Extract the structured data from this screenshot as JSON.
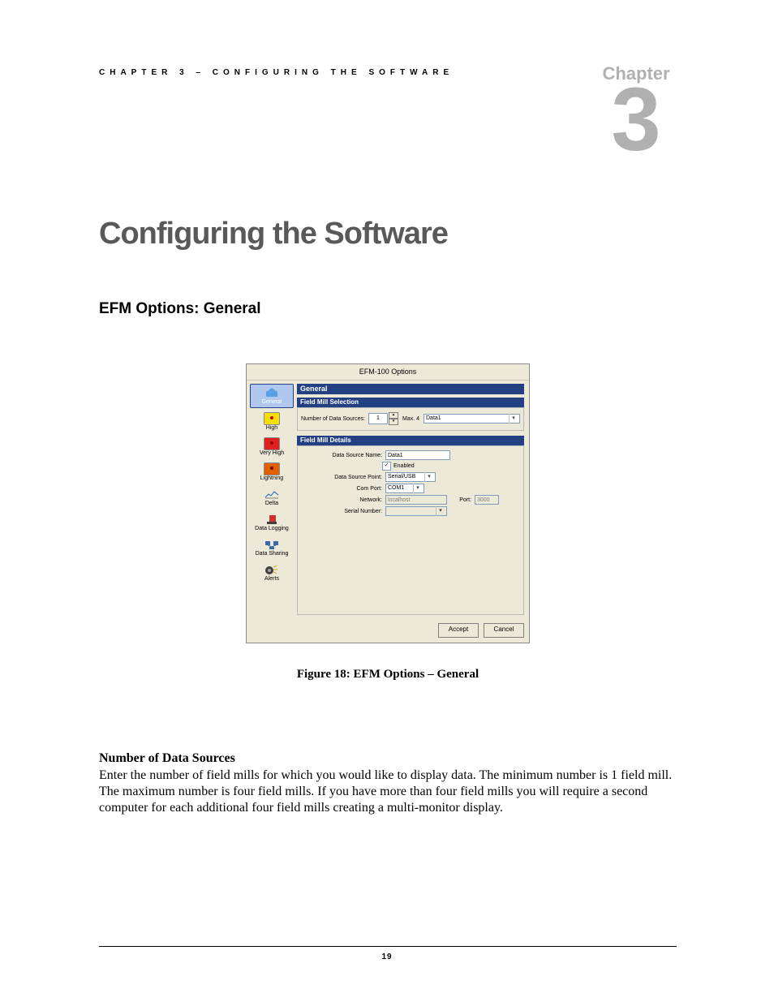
{
  "header": {
    "running_head": "CHAPTER 3 – CONFIGURING THE SOFTWARE",
    "chapter_label": "Chapter",
    "chapter_number": "3"
  },
  "title": "Configuring the Software",
  "section_head": "EFM Options: General",
  "dialog": {
    "title": "EFM-100 Options",
    "sidebar": [
      {
        "label": "General"
      },
      {
        "label": "High"
      },
      {
        "label": "Very High"
      },
      {
        "label": "Lightning"
      },
      {
        "label": "Delta"
      },
      {
        "label": "Data Logging"
      },
      {
        "label": "Data Sharing"
      },
      {
        "label": "Alerts"
      }
    ],
    "group_general": "General",
    "group_selection": "Field Mill Selection",
    "group_details": "Field Mill Details",
    "num_sources_label": "Number of Data Sources:",
    "num_sources_value": "1",
    "num_sources_max_label": "Max. 4",
    "num_sources_dropdown": "Data1",
    "ds_name_label": "Data Source Name:",
    "ds_name_value": "Data1",
    "enabled_label": "Enabled",
    "dsp_label": "Data Source Point:",
    "dsp_value": "Serial/USB",
    "com_label": "Com Port:",
    "com_value": "COM1",
    "net_label": "Network:",
    "net_value": "localhost",
    "port_label": "Port:",
    "port_value": "3000",
    "sn_label": "Serial Number:",
    "sn_value": "",
    "accept": "Accept",
    "cancel": "Cancel"
  },
  "figure_caption": "Figure 18:  EFM Options – General",
  "body": {
    "sub_head": "Number of Data Sources",
    "para": "Enter the number of field mills for which you would like to display data.  The minimum number is 1 field mill.  The maximum number is four field mills.  If you have more than four field mills you will require a second computer for each additional four field mills creating a multi-monitor display."
  },
  "page_number": "19"
}
